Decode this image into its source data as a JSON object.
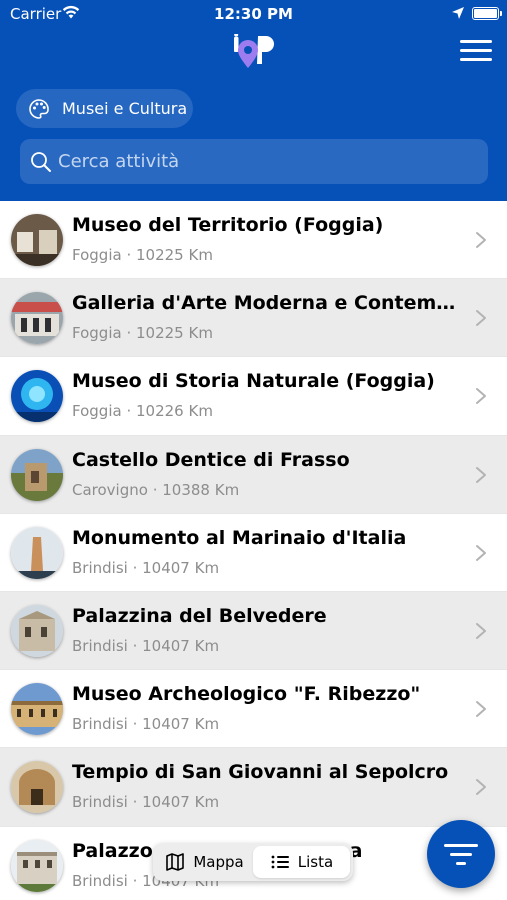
{
  "status_bar": {
    "carrier": "Carrier",
    "time": "12:30 PM"
  },
  "header": {
    "logo_icon": "iop-location-pin-logo",
    "menu_icon": "hamburger-menu-icon"
  },
  "category_chip": {
    "label": "Musei e Cultura",
    "icon": "palette-icon"
  },
  "search": {
    "placeholder": "Cerca attività",
    "value": ""
  },
  "items": [
    {
      "title": "Museo del Territorio (Foggia)",
      "city": "Foggia",
      "distance": "10225 Km"
    },
    {
      "title": "Galleria d'Arte Moderna e Contempor…",
      "city": "Foggia",
      "distance": "10225 Km"
    },
    {
      "title": "Museo di Storia Naturale (Foggia)",
      "city": "Foggia",
      "distance": "10226 Km"
    },
    {
      "title": "Castello Dentice di Frasso",
      "city": "Carovigno",
      "distance": "10388 Km"
    },
    {
      "title": "Monumento al Marinaio d'Italia",
      "city": "Brindisi",
      "distance": "10407 Km"
    },
    {
      "title": "Palazzina del Belvedere",
      "city": "Brindisi",
      "distance": "10407 Km"
    },
    {
      "title": "Museo Archeologico \"F. Ribezzo\"",
      "city": "Brindisi",
      "distance": "10407 Km"
    },
    {
      "title": "Tempio di San Giovanni al Sepolcro",
      "city": "Brindisi",
      "distance": "10407 Km"
    },
    {
      "title": "Palazzo Granafei-Nervegna",
      "city": "Brindisi",
      "distance": "10407 Km"
    }
  ],
  "view_toggle": {
    "map_label": "Mappa",
    "list_label": "Lista",
    "selected": "Lista"
  },
  "fab": {
    "icon": "filter-icon"
  },
  "colors": {
    "primary": "#0651b8",
    "row_alt": "#ebebeb",
    "meta_text": "#8d8d8d"
  }
}
